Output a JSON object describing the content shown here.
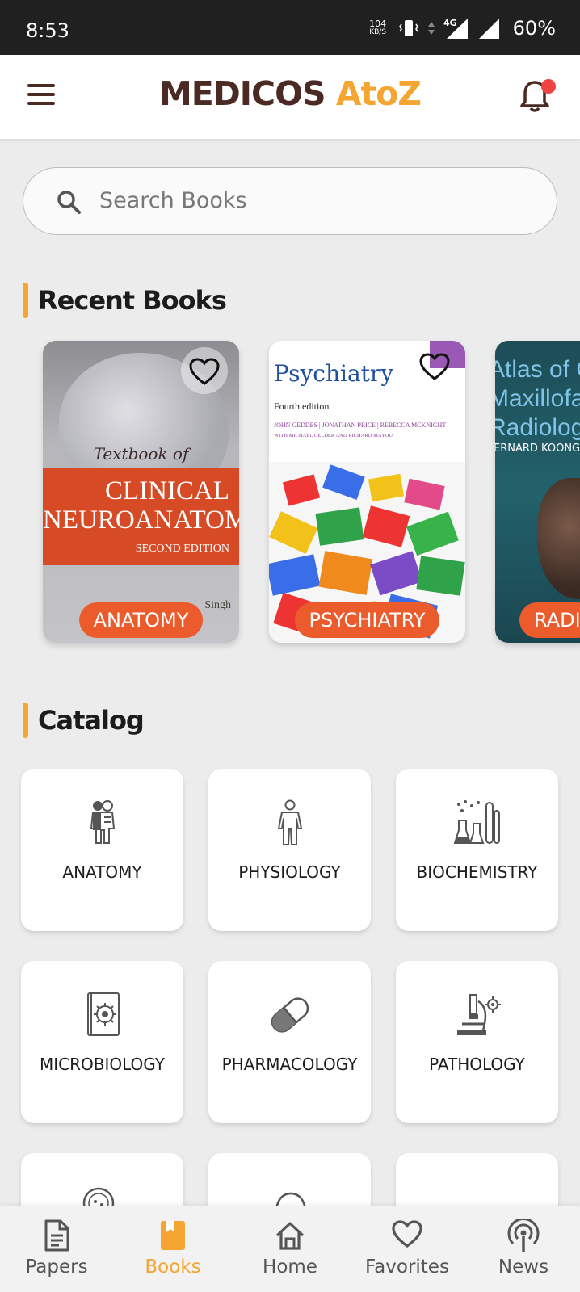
{
  "status_bar": {
    "time": "8:53",
    "net_speed_value": "104",
    "net_speed_unit": "KB/S",
    "network": "4G",
    "battery": "60%"
  },
  "app_bar": {
    "logo_part1": "MEDICOS",
    "logo_part2": "AtoZ",
    "menu_icon": "hamburger-menu-icon",
    "notification_icon": "bell-icon",
    "colors": {
      "logo_dark": "#4a2a22",
      "accent": "#f4a532",
      "badge": "#f04343"
    }
  },
  "search": {
    "placeholder": "Search Books",
    "icon": "search-icon"
  },
  "recent_books": {
    "title": "Recent Books",
    "items": [
      {
        "tag": "ANATOMY",
        "cover_line1": "Textbook of",
        "cover_line2": "CLINICAL",
        "cover_line3": "NEUROANATOMY",
        "cover_line4": "SECOND EDITION",
        "cover_author": "Singh"
      },
      {
        "tag": "PSYCHIATRY",
        "cover_title": "Psychiatry",
        "cover_edition": "Fourth edition",
        "cover_authors": "JOHN GEDDES | JONATHAN PRICE | REBECCA MCKNIGHT",
        "cover_with": "WITH MICHAEL GELDER AND RICHARD MAYOU"
      },
      {
        "tag": "RADI",
        "cover_title": "Atlas of Or\nMaxillofac\nRadiology",
        "cover_author": "ERNARD KOONG"
      }
    ]
  },
  "catalog": {
    "title": "Catalog",
    "items": [
      {
        "label": "ANATOMY",
        "icon": "skeleton-icon"
      },
      {
        "label": "PHYSIOLOGY",
        "icon": "human-body-icon"
      },
      {
        "label": "BIOCHEMISTRY",
        "icon": "lab-flasks-icon"
      },
      {
        "label": "MICROBIOLOGY",
        "icon": "microbe-book-icon"
      },
      {
        "label": "PHARMACOLOGY",
        "icon": "pill-capsule-icon"
      },
      {
        "label": "PATHOLOGY",
        "icon": "microscope-icon"
      }
    ]
  },
  "bottom_nav": {
    "items": [
      {
        "label": "Papers",
        "icon": "document-icon"
      },
      {
        "label": "Books",
        "icon": "bookmark-book-icon",
        "active": true
      },
      {
        "label": "Home",
        "icon": "home-icon"
      },
      {
        "label": "Favorites",
        "icon": "heart-icon"
      },
      {
        "label": "News",
        "icon": "broadcast-icon"
      }
    ]
  }
}
